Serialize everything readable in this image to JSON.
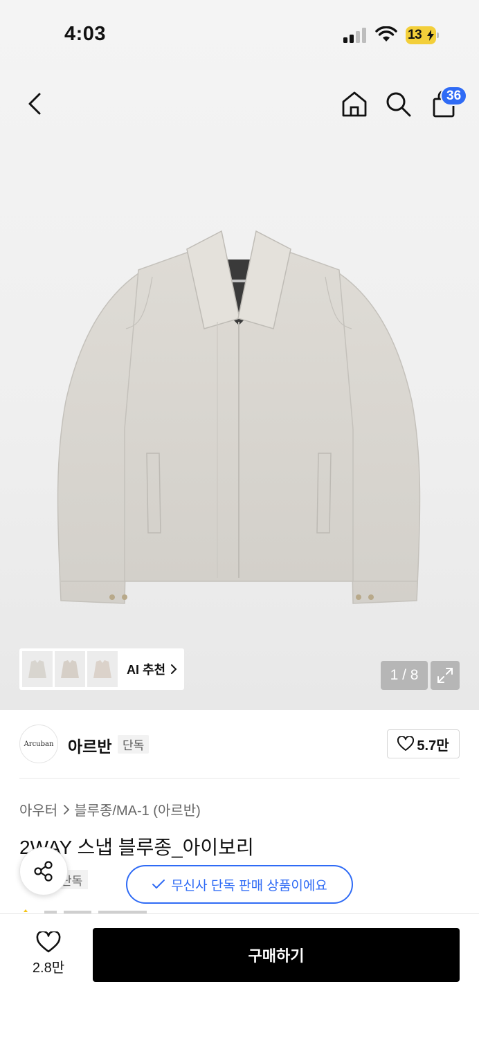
{
  "status_bar": {
    "time": "4:03",
    "battery": "13"
  },
  "header": {
    "cart_count": "36"
  },
  "gallery": {
    "ai_recommend_label": "AI 추천",
    "pager": "1 / 8",
    "product_color": "#dcd9d3"
  },
  "brand": {
    "logo_text": "Arcuban",
    "name": "아르반",
    "badge": "단독",
    "likes": "5.7만"
  },
  "breadcrumb": {
    "category": "아우터",
    "subcategory": "블루종/MA-1 (아르반)"
  },
  "product": {
    "title": "2WAY 스냅 블루종_아이보리",
    "exclusive_badge": "단독"
  },
  "toast": {
    "message": "무신사 단독 판매 상품이에요"
  },
  "bottom_bar": {
    "wish_count": "2.8만",
    "buy_label": "구매하기"
  },
  "colors": {
    "accent_blue": "#2f6bf5",
    "buy_button": "#000000"
  }
}
